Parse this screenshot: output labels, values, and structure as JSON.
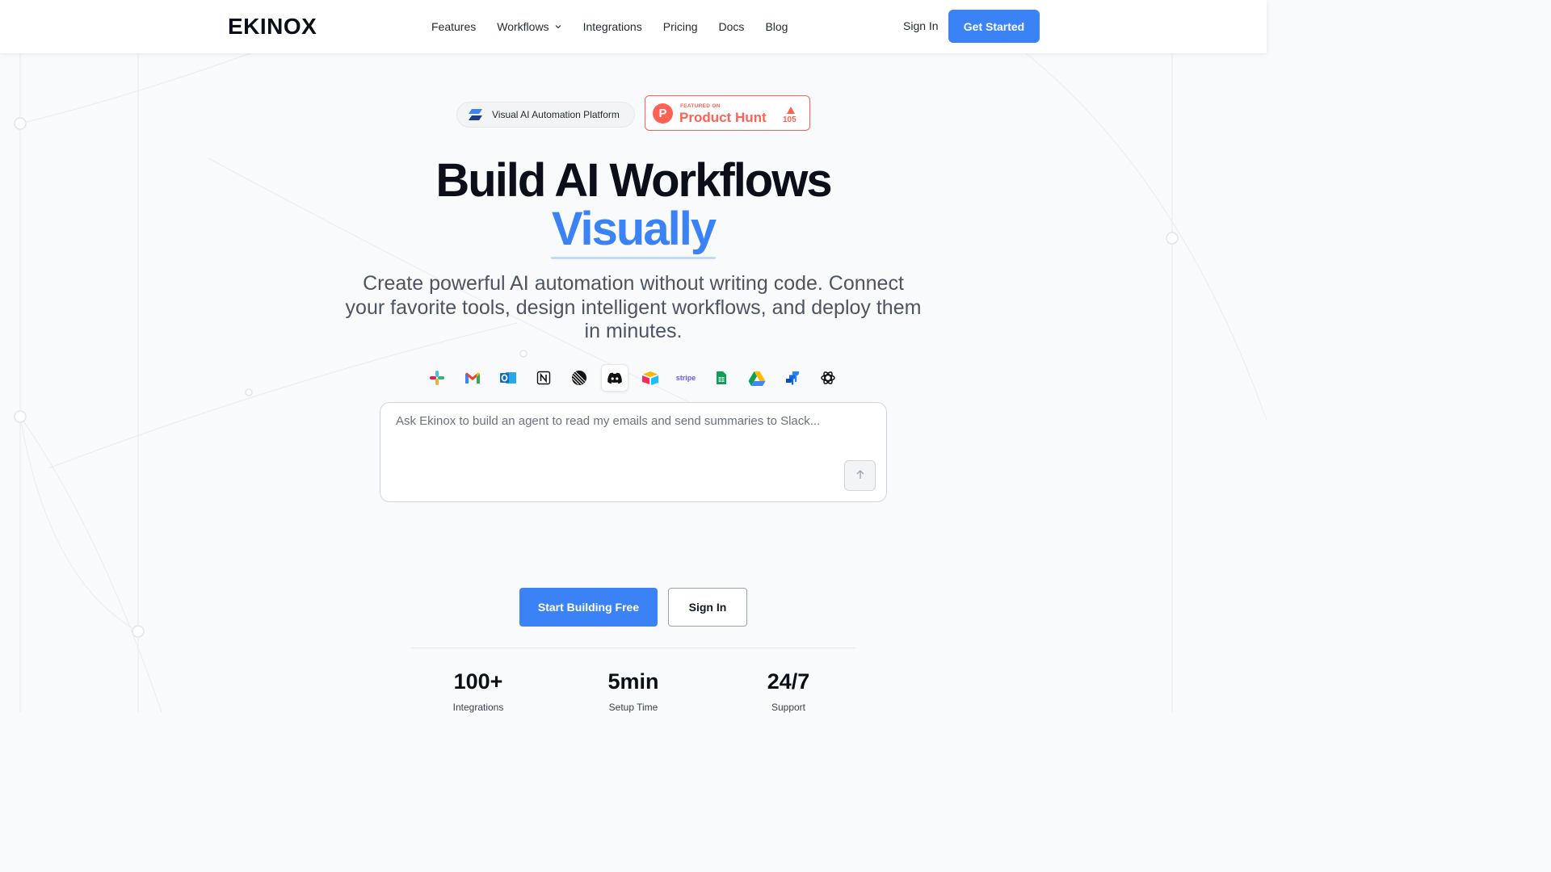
{
  "brand": {
    "name": "EKINOX"
  },
  "nav": {
    "items": [
      {
        "label": "Features",
        "has_dropdown": false
      },
      {
        "label": "Workflows",
        "has_dropdown": true
      },
      {
        "label": "Integrations",
        "has_dropdown": false
      },
      {
        "label": "Pricing",
        "has_dropdown": false
      },
      {
        "label": "Docs",
        "has_dropdown": false
      },
      {
        "label": "Blog",
        "has_dropdown": false
      }
    ],
    "sign_in": "Sign In",
    "get_started": "Get Started"
  },
  "badges": {
    "platform_pill": "Visual AI Automation Platform",
    "product_hunt": {
      "featured": "FEATURED ON",
      "name": "Product Hunt",
      "logo_letter": "P",
      "upvotes": "105"
    }
  },
  "hero": {
    "title_line1": "Build AI Workflows",
    "title_line2": "Visually",
    "subtitle": "Create powerful AI automation without writing code. Connect your favorite tools, design intelligent workflows, and deploy them in minutes."
  },
  "integrations": [
    {
      "name": "slack-icon"
    },
    {
      "name": "gmail-icon"
    },
    {
      "name": "outlook-icon"
    },
    {
      "name": "notion-icon"
    },
    {
      "name": "linear-icon"
    },
    {
      "name": "discord-icon",
      "active": true
    },
    {
      "name": "airtable-icon"
    },
    {
      "name": "stripe-icon",
      "text": "stripe"
    },
    {
      "name": "google-sheets-icon"
    },
    {
      "name": "google-drive-icon"
    },
    {
      "name": "jira-icon"
    },
    {
      "name": "openai-icon"
    }
  ],
  "prompt": {
    "placeholder": "Ask Ekinox to build an agent to read my emails and send summaries to Slack...",
    "value": ""
  },
  "cta": {
    "primary": "Start Building Free",
    "secondary": "Sign In"
  },
  "stats": [
    {
      "value": "100+",
      "label": "Integrations"
    },
    {
      "value": "5min",
      "label": "Setup Time"
    },
    {
      "value": "24/7",
      "label": "Support"
    }
  ],
  "colors": {
    "accent": "#3b82f6",
    "product_hunt": "#ff6154",
    "text_dark": "#0b0f1a",
    "text_muted": "#4b5563",
    "background": "#f9fafb"
  }
}
